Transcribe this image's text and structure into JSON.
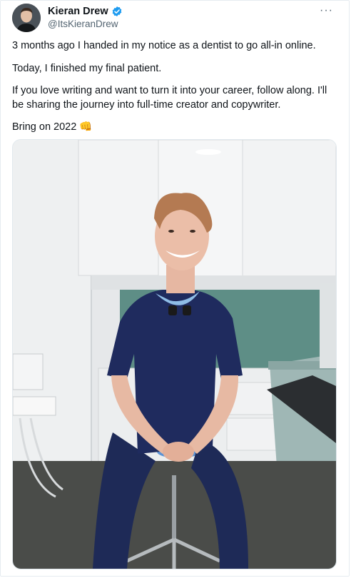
{
  "author": {
    "display_name": "Kieran Drew",
    "handle": "@ItsKieranDrew"
  },
  "tweet": {
    "paragraphs": [
      "3 months ago I handed in my notice as a dentist to go all-in online.",
      "Today, I finished my final patient.",
      "If you love writing and want to turn it into your career, follow along. I'll be sharing the journey into full-time creator and copywriter.",
      "Bring on 2022 👊"
    ]
  },
  "icons": {
    "verified": "verified-badge-icon",
    "more": "more-options-icon",
    "emoji": "fist-bump-emoji"
  },
  "colors": {
    "text": "#0f1419",
    "muted": "#536471",
    "verified_blue": "#1d9bf0"
  },
  "more_label": "···"
}
